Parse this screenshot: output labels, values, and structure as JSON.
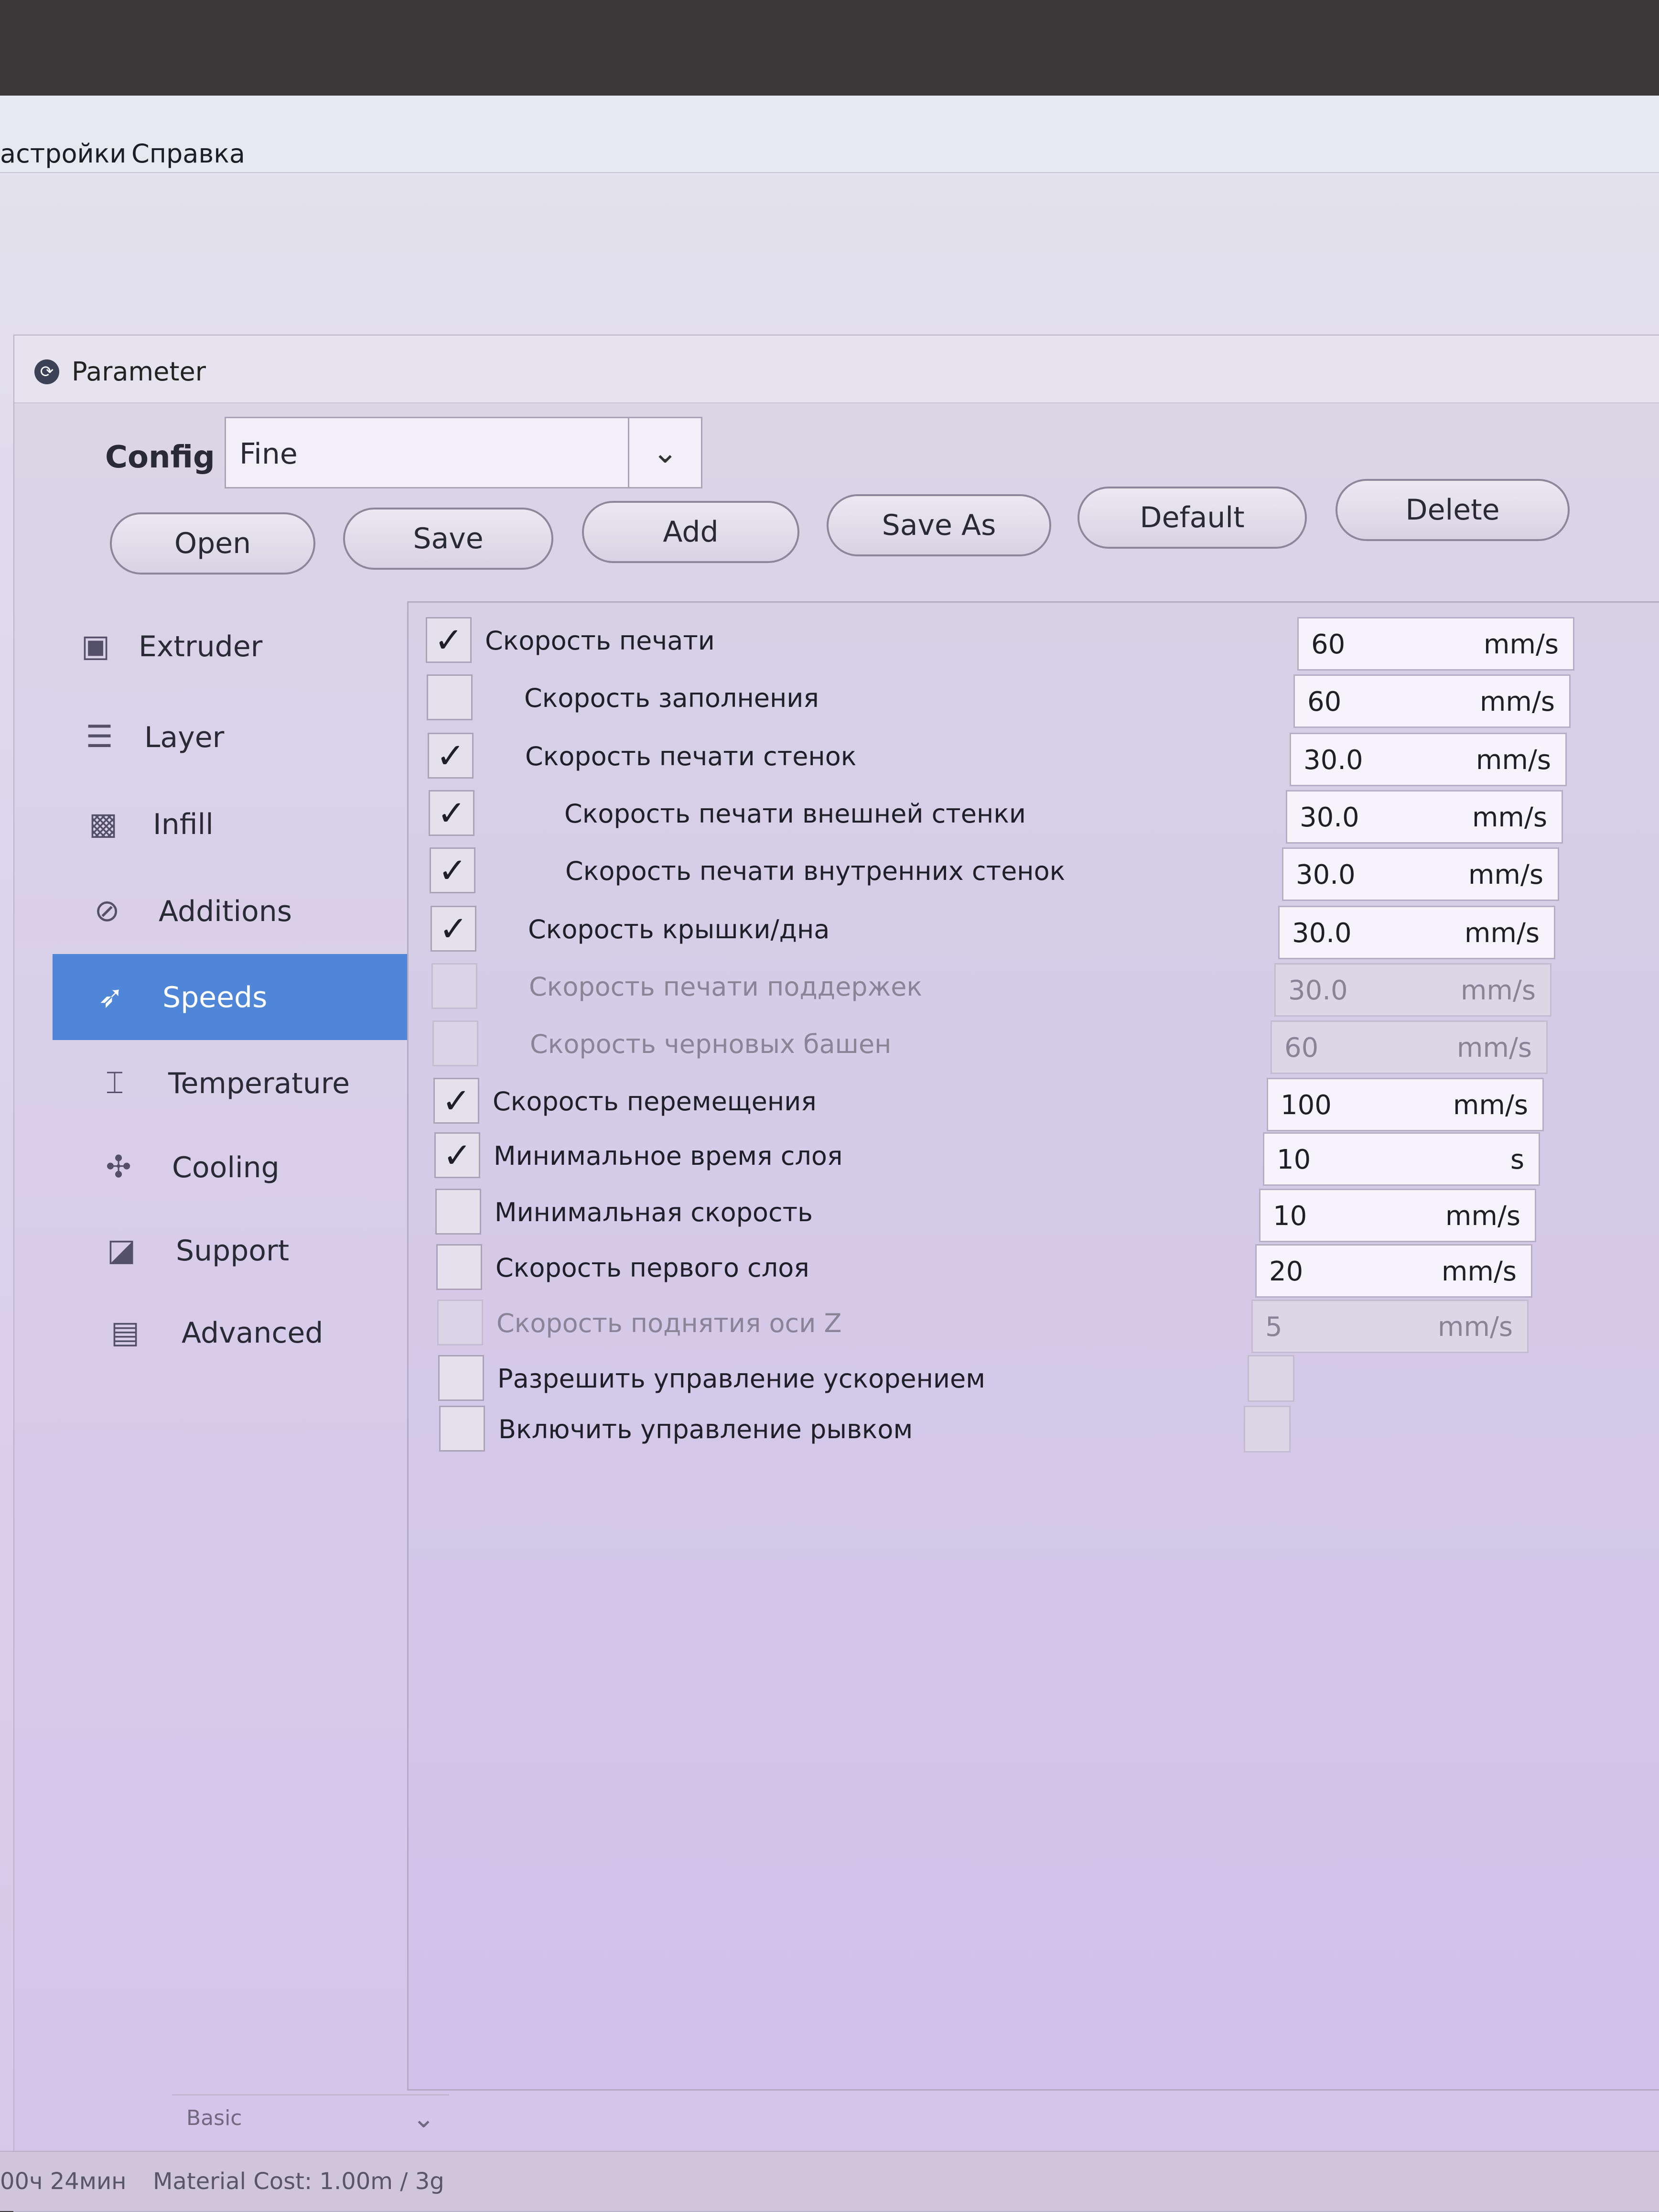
{
  "menu": {
    "items": [
      "астройки",
      "Справка"
    ]
  },
  "dialog": {
    "title": "Parameter"
  },
  "config": {
    "label": "Config",
    "selected": "Fine"
  },
  "toolbar": {
    "open": "Open",
    "save": "Save",
    "add": "Add",
    "save_as": "Save As",
    "default": "Default",
    "delete": "Delete"
  },
  "sidebar": {
    "items": [
      {
        "label": "Extruder",
        "icon": "extruder-icon"
      },
      {
        "label": "Layer",
        "icon": "layer-icon"
      },
      {
        "label": "Infill",
        "icon": "infill-icon"
      },
      {
        "label": "Additions",
        "icon": "paperclip-icon"
      },
      {
        "label": "Speeds",
        "icon": "rocket-icon",
        "active": true
      },
      {
        "label": "Temperature",
        "icon": "thermometer-icon"
      },
      {
        "label": "Cooling",
        "icon": "fan-icon"
      },
      {
        "label": "Support",
        "icon": "support-icon"
      },
      {
        "label": "Advanced",
        "icon": "briefcase-icon"
      }
    ],
    "mode": "Basic"
  },
  "settings": [
    {
      "label": "Скорость печати",
      "checked": true,
      "value": "60",
      "unit": "mm/s",
      "enabled": true
    },
    {
      "label": "Скорость заполнения",
      "checked": false,
      "value": "60",
      "unit": "mm/s",
      "enabled": true
    },
    {
      "label": "Скорость печати стенок",
      "checked": true,
      "value": "30.0",
      "unit": "mm/s",
      "enabled": true
    },
    {
      "label": "Скорость печати внешней стенки",
      "checked": true,
      "value": "30.0",
      "unit": "mm/s",
      "enabled": true
    },
    {
      "label": "Скорость печати внутренних стенок",
      "checked": true,
      "value": "30.0",
      "unit": "mm/s",
      "enabled": true
    },
    {
      "label": "Скорость крышки/дна",
      "checked": true,
      "value": "30.0",
      "unit": "mm/s",
      "enabled": true
    },
    {
      "label": "Скорость печати поддержек",
      "checked": false,
      "value": "30.0",
      "unit": "mm/s",
      "enabled": false
    },
    {
      "label": "Скорость черновых башен",
      "checked": false,
      "value": "60",
      "unit": "mm/s",
      "enabled": false
    },
    {
      "label": "Скорость перемещения",
      "checked": true,
      "value": "100",
      "unit": "mm/s",
      "enabled": true
    },
    {
      "label": "Минимальное время слоя",
      "checked": true,
      "value": "10",
      "unit": "s",
      "enabled": true
    },
    {
      "label": "Минимальная скорость",
      "checked": false,
      "value": "10",
      "unit": "mm/s",
      "enabled": true
    },
    {
      "label": "Скорость первого слоя",
      "checked": false,
      "value": "20",
      "unit": "mm/s",
      "enabled": true
    },
    {
      "label": "Скорость поднятия оси Z",
      "checked": false,
      "value": "5",
      "unit": "mm/s",
      "enabled": false
    },
    {
      "label": "Разрешить управление ускорением",
      "checked": false,
      "enabled": true
    },
    {
      "label": "Включить управление рывком",
      "checked": false,
      "enabled": true
    }
  ],
  "status": {
    "time": "00ч 24мин",
    "material": "Material Cost: 1.00m / 3g"
  }
}
